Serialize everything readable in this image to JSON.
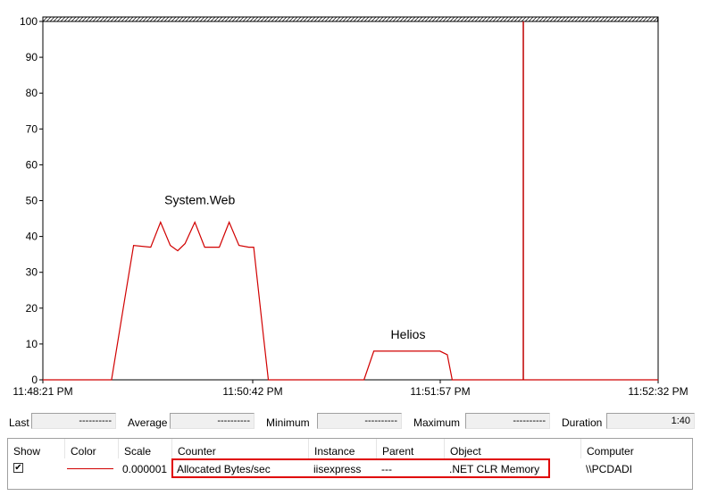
{
  "chart_data": {
    "type": "line",
    "y_ticks": [
      "0",
      "10",
      "20",
      "30",
      "40",
      "50",
      "60",
      "70",
      "80",
      "90",
      "100"
    ],
    "ylim": [
      0,
      100
    ],
    "x_tick_labels": [
      "11:48:21 PM",
      "11:50:42 PM",
      "11:51:57 PM",
      "11:52:32 PM"
    ],
    "x_range_seconds": 251,
    "grid": false,
    "series": [
      {
        "color": "#d10000",
        "points": [
          [
            0,
            0
          ],
          [
            28,
            0
          ],
          [
            34,
            25
          ],
          [
            37,
            37.5
          ],
          [
            44,
            37
          ],
          [
            48,
            44
          ],
          [
            52,
            37.5
          ],
          [
            55,
            36
          ],
          [
            58,
            38
          ],
          [
            62,
            44
          ],
          [
            66,
            37
          ],
          [
            68,
            37
          ],
          [
            72,
            37
          ],
          [
            76,
            44
          ],
          [
            80,
            37.5
          ],
          [
            84,
            37
          ],
          [
            86,
            37
          ],
          [
            90,
            12
          ],
          [
            92,
            0
          ],
          [
            110,
            0
          ],
          [
            131,
            0
          ],
          [
            135,
            8
          ],
          [
            138,
            8
          ],
          [
            144,
            8
          ],
          [
            150,
            8
          ],
          [
            156,
            8
          ],
          [
            162,
            8
          ],
          [
            165,
            7
          ],
          [
            167,
            0
          ],
          [
            200,
            0
          ],
          [
            251,
            0
          ]
        ]
      }
    ],
    "annotations": [
      {
        "text": "System.Web",
        "x": 64,
        "y": 49
      },
      {
        "text": "Helios",
        "x": 149,
        "y": 11.5
      }
    ],
    "time_cursor_seconds": 196
  },
  "stats": {
    "last_label": "Last",
    "last_value": "----------",
    "average_label": "Average",
    "average_value": "----------",
    "minimum_label": "Minimum",
    "minimum_value": "----------",
    "maximum_label": "Maximum",
    "maximum_value": "----------",
    "duration_label": "Duration",
    "duration_value": "1:40"
  },
  "legend": {
    "headers": {
      "show": "Show",
      "color": "Color",
      "scale": "Scale",
      "counter": "Counter",
      "instance": "Instance",
      "parent": "Parent",
      "object": "Object",
      "computer": "Computer"
    },
    "row": {
      "checked_glyph": "✔",
      "scale": "0.000001",
      "counter": "Allocated Bytes/sec",
      "instance": "iisexpress",
      "parent": "---",
      "object": ".NET CLR Memory",
      "computer": "\\\\PCDADI"
    },
    "line_color": "#d10000",
    "highlight_color": "#e00000"
  }
}
